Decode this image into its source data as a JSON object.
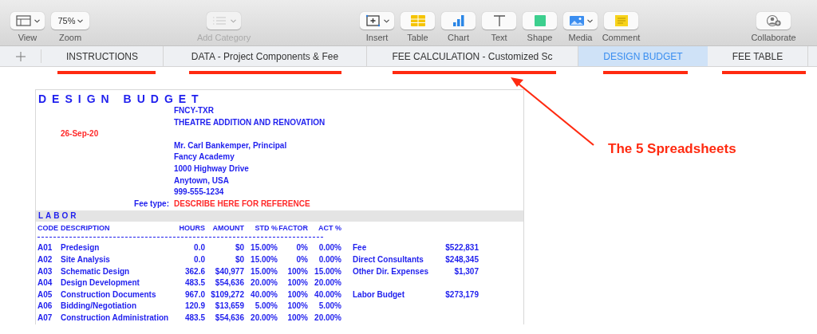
{
  "toolbar": {
    "items": [
      {
        "kind": "view",
        "label": "View",
        "disabled": false
      },
      {
        "kind": "zoom",
        "label": "Zoom",
        "value": "75%",
        "disabled": false
      },
      {
        "kind": "category",
        "label": "Add Category",
        "disabled": true
      },
      {
        "kind": "insert",
        "label": "Insert",
        "disabled": false
      },
      {
        "kind": "table",
        "label": "Table",
        "disabled": false
      },
      {
        "kind": "chart",
        "label": "Chart",
        "disabled": false
      },
      {
        "kind": "text",
        "label": "Text",
        "disabled": false
      },
      {
        "kind": "shape",
        "label": "Shape",
        "disabled": false
      },
      {
        "kind": "media",
        "label": "Media",
        "disabled": false
      },
      {
        "kind": "comment",
        "label": "Comment",
        "disabled": false
      },
      {
        "kind": "collaborate",
        "label": "Collaborate",
        "disabled": false
      }
    ]
  },
  "tabs": [
    {
      "label": "INSTRUCTIONS",
      "selected": false,
      "underlined": true
    },
    {
      "label": "DATA - Project Components & Fee",
      "selected": false,
      "underlined": true
    },
    {
      "label": "FEE CALCULATION - Customized Sc",
      "selected": false,
      "underlined": true
    },
    {
      "label": "DESIGN BUDGET",
      "selected": true,
      "underlined": true
    },
    {
      "label": "FEE TABLE",
      "selected": false,
      "underlined": true
    }
  ],
  "annotation": {
    "text": "The 5 Spreadsheets"
  },
  "sheet": {
    "title": "DESIGN BUDGET",
    "project_code": "FNCY-TXR",
    "project_name": "THEATRE ADDITION AND RENOVATION",
    "date": "26-Sep-20",
    "client": [
      "Mr. Carl Bankemper, Principal",
      "Fancy Academy",
      "1000 Highway Drive",
      "Anytown, USA",
      "999-555-1234"
    ],
    "fee_type_label": "Fee type:",
    "fee_type": "DESCRIBE HERE FOR REFERENCE",
    "section": "LABOR",
    "columns": [
      "CODE",
      "DESCRIPTION",
      "HOURS",
      "AMOUNT",
      "STD %",
      "FACTOR",
      "ACT %"
    ],
    "rows": [
      {
        "code": "A01",
        "description": "Predesign",
        "hours": "0.0",
        "amount": "$0",
        "std": "15.00%",
        "factor": "0%",
        "act": "0.00%",
        "note_label": "Fee",
        "note_value": "$522,831"
      },
      {
        "code": "A02",
        "description": "Site Analysis",
        "hours": "0.0",
        "amount": "$0",
        "std": "15.00%",
        "factor": "0%",
        "act": "0.00%",
        "note_label": "Direct Consultants",
        "note_value": "$248,345"
      },
      {
        "code": "A03",
        "description": "Schematic Design",
        "hours": "362.6",
        "amount": "$40,977",
        "std": "15.00%",
        "factor": "100%",
        "act": "15.00%",
        "note_label": "Other Dir. Expenses",
        "note_value": "$1,307"
      },
      {
        "code": "A04",
        "description": "Design Development",
        "hours": "483.5",
        "amount": "$54,636",
        "std": "20.00%",
        "factor": "100%",
        "act": "20.00%"
      },
      {
        "code": "A05",
        "description": "Construction Documents",
        "hours": "967.0",
        "amount": "$109,272",
        "std": "40.00%",
        "factor": "100%",
        "act": "40.00%",
        "note_label": "Labor Budget",
        "note_value": "$273,179"
      },
      {
        "code": "A06",
        "description": "Bidding/Negotiation",
        "hours": "120.9",
        "amount": "$13,659",
        "std": "5.00%",
        "factor": "100%",
        "act": "5.00%"
      },
      {
        "code": "A07",
        "description": "Construction Administration",
        "hours": "483.5",
        "amount": "$54,636",
        "std": "20.00%",
        "factor": "100%",
        "act": "20.00%"
      }
    ]
  }
}
